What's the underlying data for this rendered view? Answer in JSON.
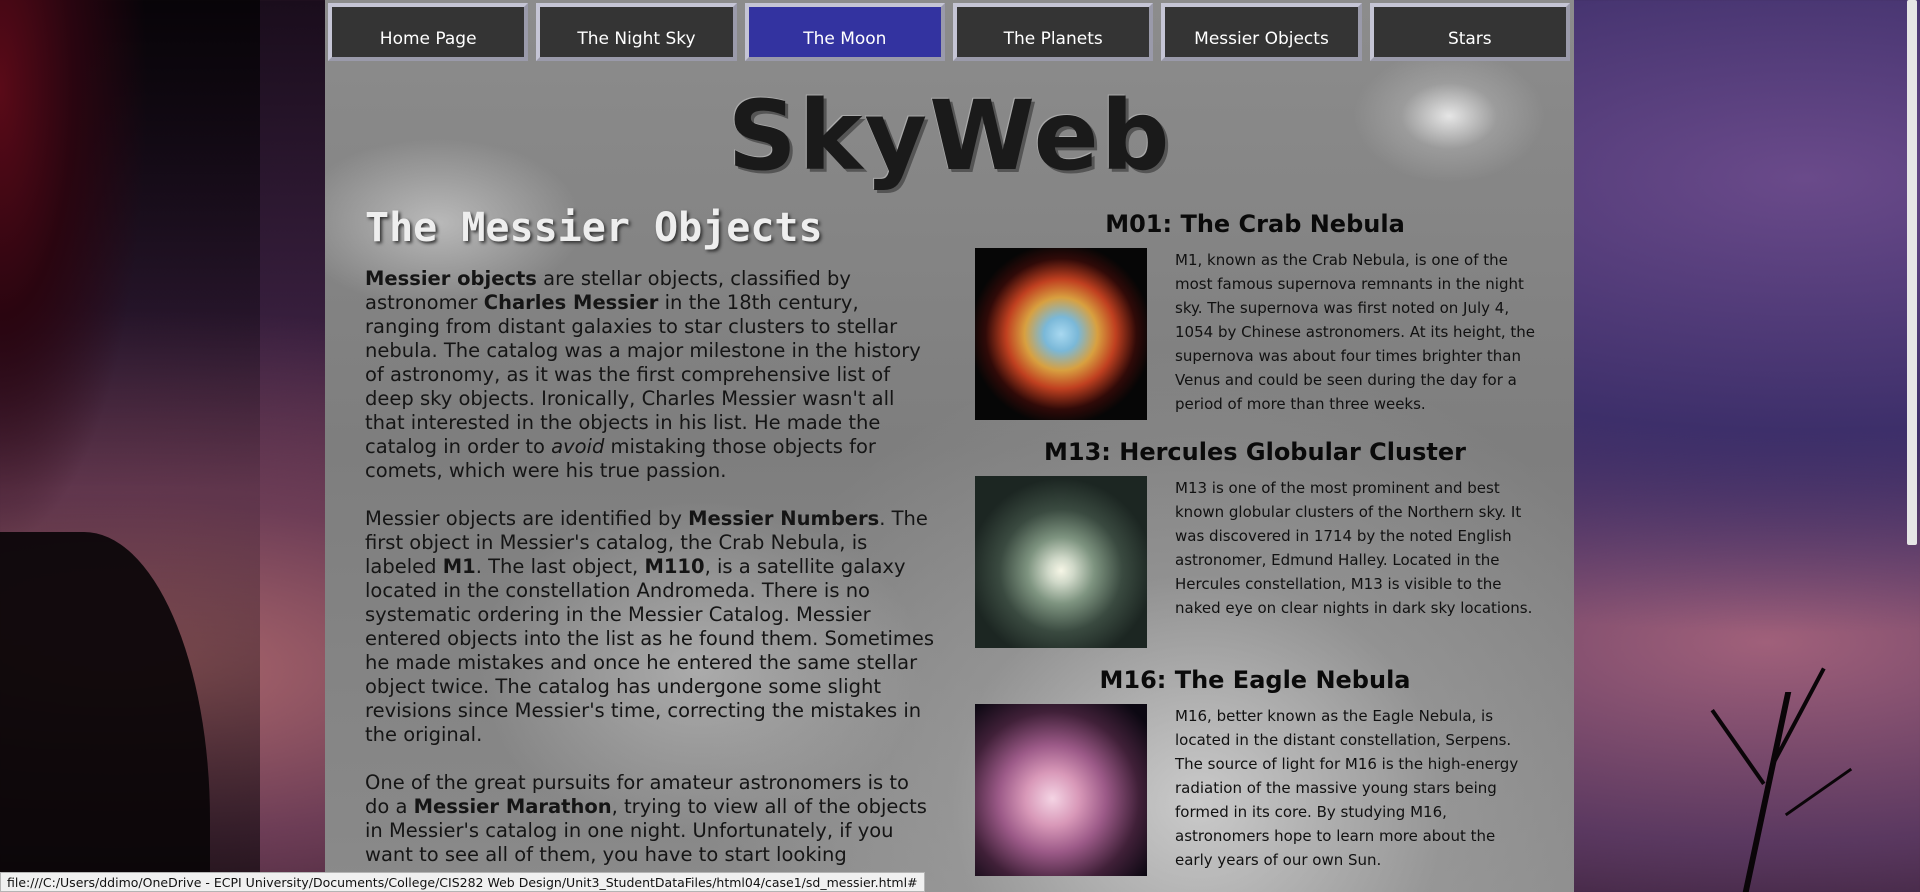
{
  "nav": {
    "items": [
      {
        "label": "Home Page"
      },
      {
        "label": "The Night Sky"
      },
      {
        "label": "The Moon"
      },
      {
        "label": "The Planets"
      },
      {
        "label": "Messier Objects"
      },
      {
        "label": "Stars"
      }
    ],
    "active_index": 2
  },
  "logo": "SkyWeb",
  "article": {
    "title": "The Messier Objects",
    "p1": {
      "b1": "Messier objects",
      "t1": " are stellar objects, classified by astronomer ",
      "b2": "Charles Messier",
      "t2": " in the 18th century, ranging from distant galaxies to star clusters to stellar nebula. The catalog was a major milestone in the history of astronomy, as it was the first comprehensive list of deep sky objects. Ironically, Charles Messier wasn't all that interested in the objects in his list. He made the catalog in order to ",
      "i1": "avoid",
      "t3": " mistaking those objects for comets, which were his true passion."
    },
    "p2": {
      "t1": "Messier objects are identified by ",
      "b1": "Messier Numbers",
      "t2": ". The first object in Messier's catalog, the Crab Nebula, is labeled ",
      "b2": "M1",
      "t3": ". The last object, ",
      "b3": "M110",
      "t4": ", is a satellite galaxy located in the constellation Andromeda. There is no systematic ordering in the Messier Catalog. Messier entered objects into the list as he found them. Sometimes he made mistakes and once he entered the same stellar object twice. The catalog has undergone some slight revisions since Messier's time, correcting the mistakes in the original."
    },
    "p3": {
      "t1": "One of the great pursuits for amateur astronomers is to do a ",
      "b1": "Messier Marathon",
      "t2": ", trying to view all of the objects in Messier's catalog in one night. Unfortunately, if you want to see all of them, you have to start looking"
    }
  },
  "objects": [
    {
      "title": "M01: The Crab Nebula",
      "text": "M1, known as the Crab Nebula, is one of the most famous supernova remnants in the night sky. The supernova was first noted on July 4, 1054 by Chinese astronomers. At its height, the supernova was about four times brighter than Venus and could be seen during the day for a period of more than three weeks."
    },
    {
      "title": "M13: Hercules Globular Cluster",
      "text": "M13 is one of the most prominent and best known globular clusters of the Northern sky. It was discovered in 1714 by the noted English astronomer, Edmund Halley. Located in the Hercules constellation, M13 is visible to the naked eye on clear nights in dark sky locations."
    },
    {
      "title": "M16: The Eagle Nebula",
      "text": "M16, better known as the Eagle Nebula, is located in the distant constellation, Serpens. The source of light for M16 is the high-energy radiation of the massive young stars being formed in its core. By studying M16, astronomers hope to learn more about the early years of our own Sun."
    }
  ],
  "status_url": "file:///C:/Users/ddimo/OneDrive - ECPI University/Documents/College/CIS282 Web Design/Unit3_StudentDataFiles/html04/case1/sd_messier.html#"
}
